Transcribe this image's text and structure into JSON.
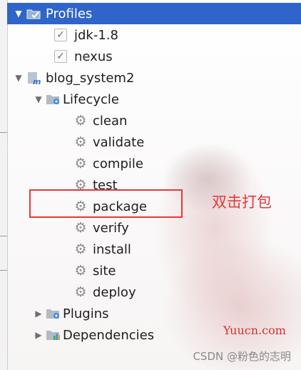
{
  "tree": {
    "profiles": {
      "label": "Profiles",
      "expanded": true
    },
    "profile_items": [
      {
        "label": "jdk-1.8",
        "checked": true
      },
      {
        "label": "nexus",
        "checked": true
      }
    ],
    "project": {
      "label": "blog_system2",
      "expanded": true
    },
    "lifecycle": {
      "label": "Lifecycle",
      "expanded": true
    },
    "lifecycle_phases": [
      "clean",
      "validate",
      "compile",
      "test",
      "package",
      "verify",
      "install",
      "site",
      "deploy"
    ],
    "plugins": {
      "label": "Plugins",
      "expanded": false
    },
    "dependencies": {
      "label": "Dependencies",
      "expanded": false
    }
  },
  "annotation": {
    "text": "双击打包",
    "color": "#e23a3a"
  },
  "watermarks": {
    "site": "Yuucn.com",
    "csdn": "CSDN @粉色的志明"
  },
  "colors": {
    "selection": "#2f65ca",
    "gear": "#8a8f96",
    "highlight": "#e23a3a"
  }
}
